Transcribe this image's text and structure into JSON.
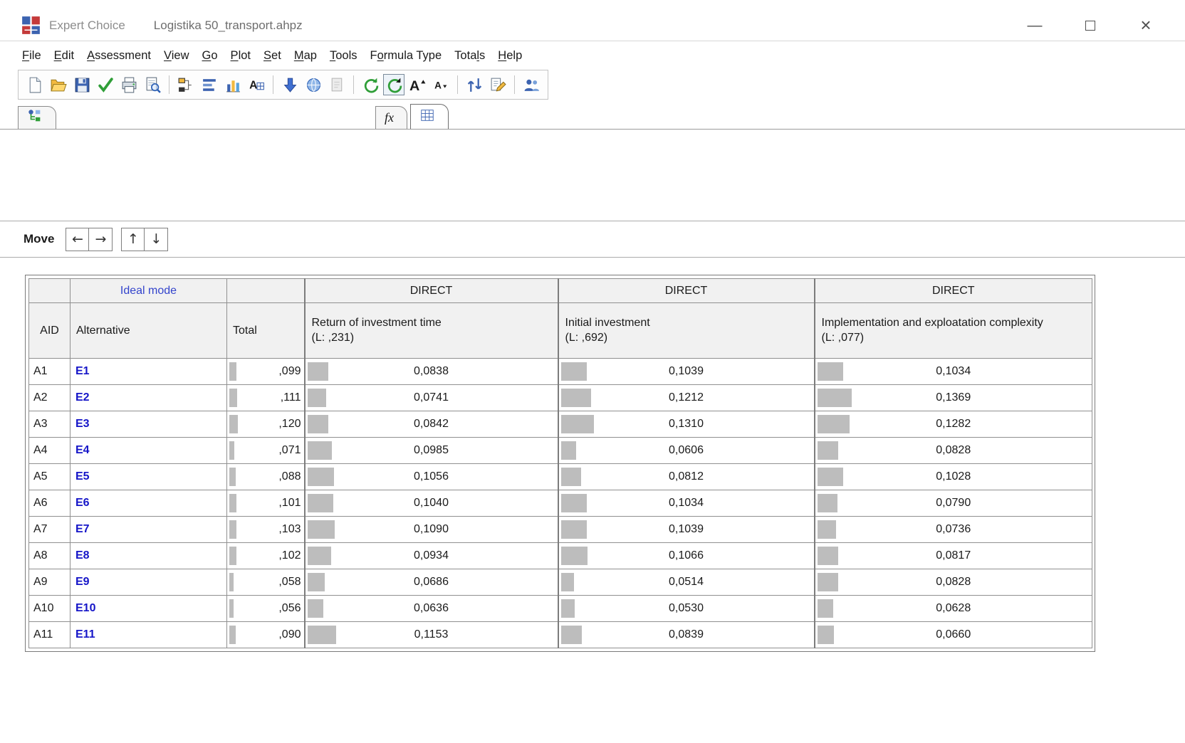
{
  "window": {
    "app_title": "Expert Choice",
    "file_title": "Logistika 50_transport.ahpz",
    "controls": {
      "minimize": "—",
      "close": "×"
    }
  },
  "menu": {
    "items": [
      {
        "label": "File",
        "u": 0
      },
      {
        "label": "Edit",
        "u": 0
      },
      {
        "label": "Assessment",
        "u": 0
      },
      {
        "label": "View",
        "u": 0
      },
      {
        "label": "Go",
        "u": 0
      },
      {
        "label": "Plot",
        "u": 0
      },
      {
        "label": "Set",
        "u": 0
      },
      {
        "label": "Map",
        "u": 0
      },
      {
        "label": "Tools",
        "u": 0
      },
      {
        "label": "Formula Type",
        "u": 1
      },
      {
        "label": "Totals",
        "u": 4
      },
      {
        "label": "Help",
        "u": 0
      }
    ]
  },
  "toolbar": {
    "icons": [
      "new-document",
      "open-folder",
      "save",
      "apply-check",
      "print",
      "print-preview",
      "|",
      "tree-view",
      "list-bars",
      "bar-chart",
      "format-cells",
      "|",
      "download-arrow",
      "sphere",
      "inactive-page",
      "|",
      "refresh",
      "refresh-active",
      "font-increase",
      "font-decrease",
      "|",
      "compare-arrows",
      "edit-formula",
      "|",
      "participants"
    ]
  },
  "tabs": {
    "formula_tab_label": "fx"
  },
  "move_bar": {
    "label": "Move",
    "buttons": [
      "←",
      "→",
      "↑",
      "↓"
    ]
  },
  "grid": {
    "ideal_mode_label": "Ideal mode",
    "direct_label": "DIRECT",
    "aid_header": "AID",
    "alternative_header": "Alternative",
    "total_header": "Total",
    "criteria": [
      {
        "title": "Return of investment time",
        "weight": "(L: ,231)"
      },
      {
        "title": "Initial investment",
        "weight": "(L: ,692)"
      },
      {
        "title": "Implementation and exploatation complexity",
        "weight": "(L: ,077)"
      }
    ],
    "rows": [
      {
        "aid": "A1",
        "alt": "E1",
        "total": ",099",
        "values": [
          "0,0838",
          "0,1039",
          "0,1034"
        ]
      },
      {
        "aid": "A2",
        "alt": "E2",
        "total": ",111",
        "values": [
          "0,0741",
          "0,1212",
          "0,1369"
        ]
      },
      {
        "aid": "A3",
        "alt": "E3",
        "total": ",120",
        "values": [
          "0,0842",
          "0,1310",
          "0,1282"
        ]
      },
      {
        "aid": "A4",
        "alt": "E4",
        "total": ",071",
        "values": [
          "0,0985",
          "0,0606",
          "0,0828"
        ]
      },
      {
        "aid": "A5",
        "alt": "E5",
        "total": ",088",
        "values": [
          "0,1056",
          "0,0812",
          "0,1028"
        ]
      },
      {
        "aid": "A6",
        "alt": "E6",
        "total": ",101",
        "values": [
          "0,1040",
          "0,1034",
          "0,0790"
        ]
      },
      {
        "aid": "A7",
        "alt": "E7",
        "total": ",103",
        "values": [
          "0,1090",
          "0,1039",
          "0,0736"
        ]
      },
      {
        "aid": "A8",
        "alt": "E8",
        "total": ",102",
        "values": [
          "0,0934",
          "0,1066",
          "0,0817"
        ]
      },
      {
        "aid": "A9",
        "alt": "E9",
        "total": ",058",
        "values": [
          "0,0686",
          "0,0514",
          "0,0828"
        ]
      },
      {
        "aid": "A10",
        "alt": "E10",
        "total": ",056",
        "values": [
          "0,0636",
          "0,0530",
          "0,0628"
        ]
      },
      {
        "aid": "A11",
        "alt": "E11",
        "total": ",090",
        "values": [
          "0,1153",
          "0,0839",
          "0,0660"
        ]
      }
    ]
  }
}
